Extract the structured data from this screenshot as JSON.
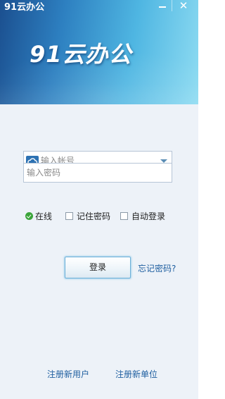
{
  "window": {
    "title": "91云办公",
    "minimize_icon": "minimize-icon",
    "close_icon": "close-icon",
    "close_glyph": "✕"
  },
  "banner": {
    "logo_text": "91云办公",
    "gradient_colors": [
      "#1b4f8f",
      "#2d7fc0",
      "#4fb6e2",
      "#8fdcf2"
    ]
  },
  "account": {
    "icon": "cloud-icon",
    "placeholder": "输入帐号",
    "dropdown_icon": "chevron-down-icon"
  },
  "password": {
    "placeholder": "输入密码"
  },
  "options": {
    "online_status": "在线",
    "online_icon": "check-circle-icon",
    "remember_password": "记住密码",
    "remember_checked": false,
    "auto_login": "自动登录",
    "auto_login_checked": false
  },
  "actions": {
    "login_label": "登录",
    "forgot_password": "忘记密码?"
  },
  "footer": {
    "register_user": "注册新用户",
    "register_org": "注册新单位"
  },
  "colors": {
    "background": "#edf2f8",
    "link": "#1f5fa0",
    "online_green": "#3aa43a",
    "cloud_badge": "#2d72b3"
  }
}
